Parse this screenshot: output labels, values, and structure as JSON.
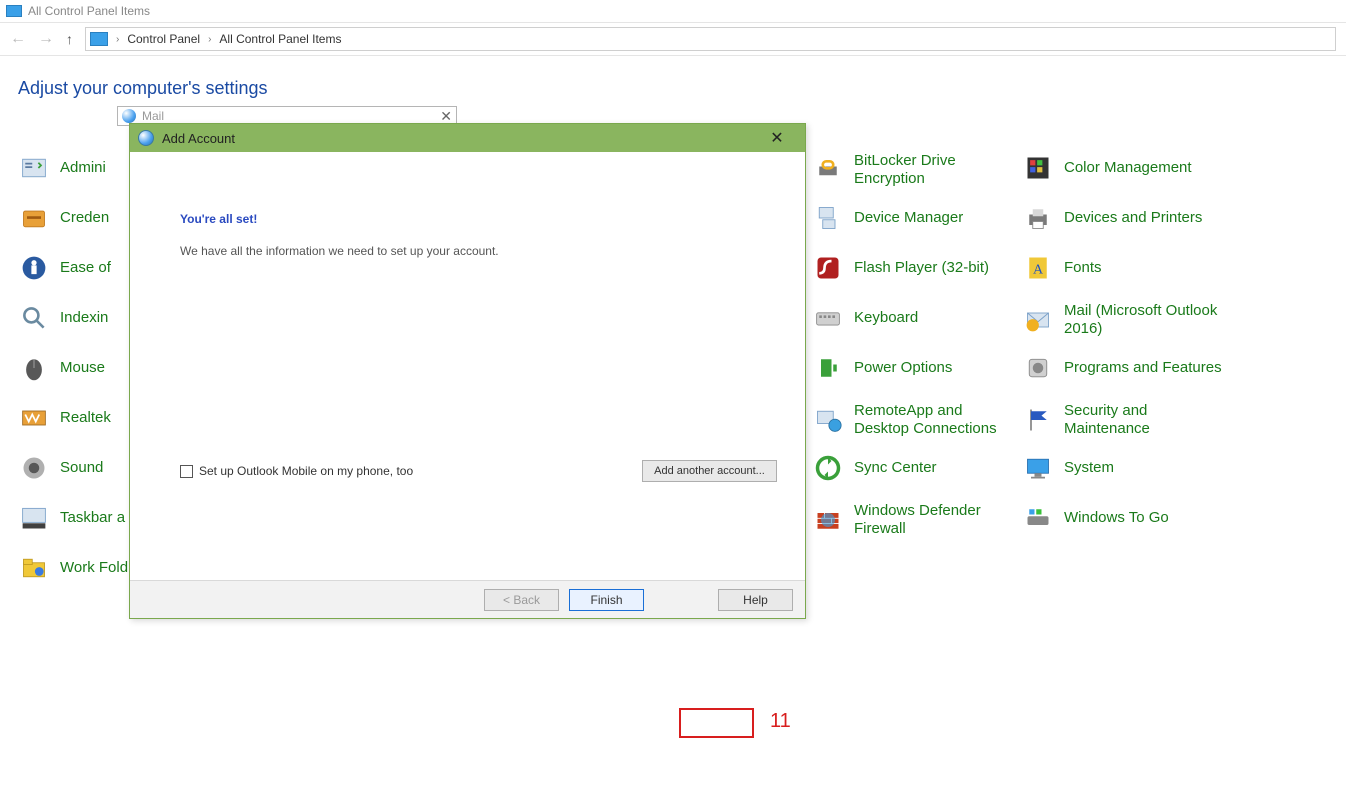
{
  "window": {
    "title": "All Control Panel Items"
  },
  "breadcrumb": {
    "root": "Control Panel",
    "leaf": "All Control Panel Items"
  },
  "heading": "Adjust your computer's settings",
  "col_a": {
    "r1": "Admini",
    "r2": "Creden",
    "r3": "Ease of",
    "r4": "Indexin",
    "r5": "Mouse",
    "r6": "Realtek",
    "r7": "Sound",
    "r8": "Taskbar a",
    "r9": "Work Fold"
  },
  "col_d": {
    "r1": "BitLocker Drive Encryption",
    "r2": "Device Manager",
    "r3": "Flash Player (32-bit)",
    "r4": "Keyboard",
    "r5": "Power Options",
    "r6": "RemoteApp and Desktop Connections",
    "r7": "Sync Center",
    "r8": "Windows Defender Firewall"
  },
  "col_e": {
    "r1": "Color Management",
    "r2": "Devices and Printers",
    "r3": "Fonts",
    "r4": "Mail (Microsoft Outlook 2016)",
    "r5": "Programs and Features",
    "r6": "Security and Maintenance",
    "r7": "System",
    "r8": "Windows To Go"
  },
  "mail_window": {
    "title": "Mail"
  },
  "dialog": {
    "title": "Add Account",
    "confirm_heading": "You're all set!",
    "confirm_sub": "We have all the information we need to set up your account.",
    "checkbox_label": "Set up Outlook Mobile on my phone, too",
    "add_another": "Add another account...",
    "back": "< Back",
    "finish": "Finish",
    "help": "Help"
  },
  "annotation": {
    "number": "11"
  }
}
